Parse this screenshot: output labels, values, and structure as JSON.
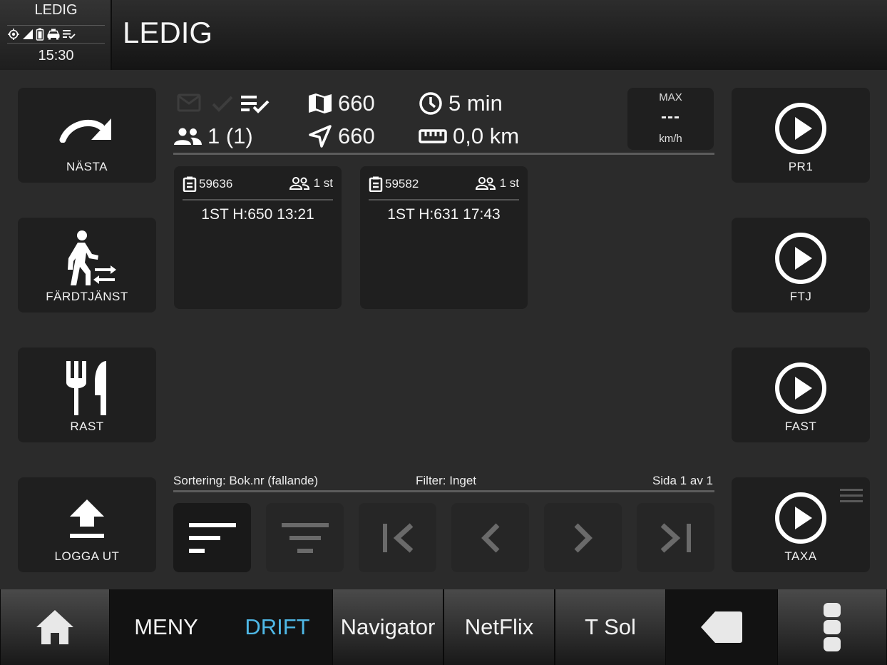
{
  "status": {
    "title": "LEDIG",
    "clock": "15:30",
    "icons": [
      "gps-icon",
      "signal-icon",
      "battery-icon",
      "taxi-icon",
      "checklist-icon"
    ]
  },
  "header": {
    "title": "LEDIG"
  },
  "left_buttons": [
    {
      "label": "NÄSTA",
      "icon": "redo-arrow-icon"
    },
    {
      "label": "FÄRDTJÄNST",
      "icon": "walking-person-exchange-icon"
    },
    {
      "label": "RAST",
      "icon": "fork-knife-icon"
    },
    {
      "label": "LOGGA UT",
      "icon": "upload-icon"
    }
  ],
  "right_buttons": [
    {
      "label": "PR1",
      "icon": "play-circle-icon"
    },
    {
      "label": "FTJ",
      "icon": "play-circle-icon"
    },
    {
      "label": "FAST",
      "icon": "play-circle-icon"
    },
    {
      "label": "TAXA",
      "icon": "play-circle-icon"
    }
  ],
  "info": {
    "zone": "660",
    "time": "5 min",
    "passengers": "1 (1)",
    "position_zone": "660",
    "distance": "0,0 km"
  },
  "speed": {
    "max_label": "MAX",
    "value": "---",
    "unit": "km/h"
  },
  "bookings": [
    {
      "number": "59636",
      "count": "1 st",
      "text": "1ST H:650 13:21"
    },
    {
      "number": "59582",
      "count": "1 st",
      "text": "1ST H:631 17:43"
    }
  ],
  "sort_bar": {
    "sorting": "Sortering: Bok.nr (fallande)",
    "filter": "Filter: Inget",
    "page": "Sida 1 av 1"
  },
  "pager_icons": [
    "sort-icon",
    "filter-icon",
    "first-page-icon",
    "previous-page-icon",
    "next-page-icon",
    "last-page-icon"
  ],
  "nav": {
    "home_icon": "home-icon",
    "items": [
      "MENY",
      "DRIFT",
      "Navigator",
      "NetFlix",
      "T Sol"
    ],
    "active": "DRIFT",
    "back_icon": "back-arrow-icon",
    "more_icon": "more-vertical-icon"
  },
  "colors": {
    "background": "#2b2b2b",
    "tile": "#1f1f1f",
    "active_nav": "#4fb8e6"
  }
}
